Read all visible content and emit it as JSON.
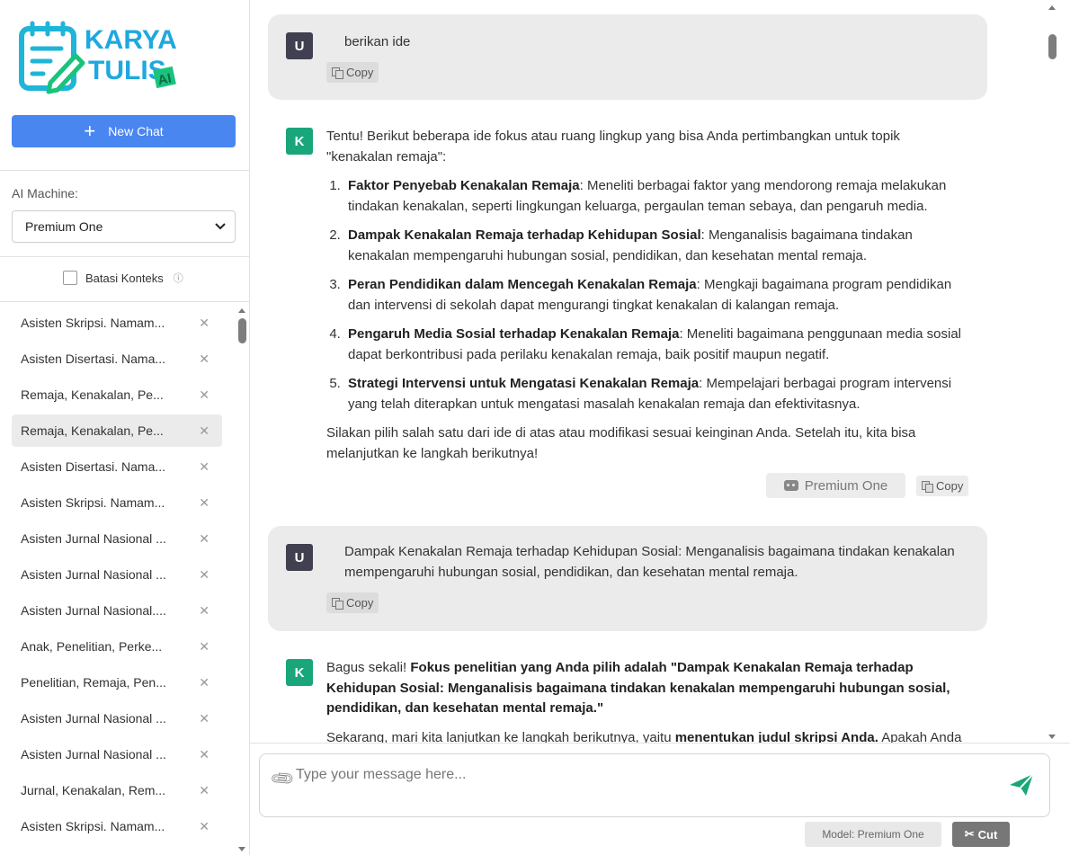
{
  "sidebar": {
    "logo": {
      "line1": "KARYA",
      "line2": "TULIS",
      "badge": "AI",
      "colors": {
        "primary": "#1fa8e0",
        "accent": "#19c37d"
      }
    },
    "new_chat_label": "New Chat",
    "ai_machine_label": "AI Machine:",
    "ai_machine_value": "Premium One",
    "batasi_label": "Batasi Konteks",
    "history": [
      "Asisten Skripsi. Namam...",
      "Asisten Disertasi. Nama...",
      "Remaja, Kenakalan, Pe...",
      "Remaja, Kenakalan, Pe...",
      "Asisten Disertasi. Nama...",
      "Asisten Skripsi. Namam...",
      "Asisten Jurnal Nasional ...",
      "Asisten Jurnal Nasional ...",
      "Asisten Jurnal Nasional....",
      "Anak, Penelitian, Perke...",
      "Penelitian, Remaja, Pen...",
      "Asisten Jurnal Nasional ...",
      "Asisten Jurnal Nasional ...",
      "Jurnal, Kenakalan, Rem...",
      "Asisten Skripsi. Namam..."
    ],
    "active_index": 3
  },
  "chat": {
    "user_avatar": "U",
    "ai_avatar": "K",
    "copy_label": "Copy",
    "msg1": "berikan ide",
    "ai1": {
      "intro": "Tentu! Berikut beberapa ide fokus atau ruang lingkup yang bisa Anda pertimbangkan untuk topik \"kenakalan remaja\":",
      "items": [
        {
          "title": "Faktor Penyebab Kenakalan Remaja",
          "desc": ": Meneliti berbagai faktor yang mendorong remaja melakukan tindakan kenakalan, seperti lingkungan keluarga, pergaulan teman sebaya, dan pengaruh media."
        },
        {
          "title": "Dampak Kenakalan Remaja terhadap Kehidupan Sosial",
          "desc": ": Menganalisis bagaimana tindakan kenakalan mempengaruhi hubungan sosial, pendidikan, dan kesehatan mental remaja."
        },
        {
          "title": "Peran Pendidikan dalam Mencegah Kenakalan Remaja",
          "desc": ": Mengkaji bagaimana program pendidikan dan intervensi di sekolah dapat mengurangi tingkat kenakalan di kalangan remaja."
        },
        {
          "title": "Pengaruh Media Sosial terhadap Kenakalan Remaja",
          "desc": ": Meneliti bagaimana penggunaan media sosial dapat berkontribusi pada perilaku kenakalan remaja, baik positif maupun negatif."
        },
        {
          "title": "Strategi Intervensi untuk Mengatasi Kenakalan Remaja",
          "desc": ": Mempelajari berbagai program intervensi yang telah diterapkan untuk mengatasi masalah kenakalan remaja dan efektivitasnya."
        }
      ],
      "outro": "Silakan pilih salah satu dari ide di atas atau modifikasi sesuai keinginan Anda. Setelah itu, kita bisa melanjutkan ke langkah berikutnya!",
      "model": "Premium One"
    },
    "msg2": "Dampak Kenakalan Remaja terhadap Kehidupan Sosial: Menganalisis bagaimana tindakan kenakalan mempengaruhi hubungan sosial, pendidikan, dan kesehatan mental remaja.",
    "ai2": {
      "lead": "Bagus sekali! ",
      "bold": "Fokus penelitian yang Anda pilih adalah \"Dampak Kenakalan Remaja terhadap Kehidupan Sosial: Menganalisis bagaimana tindakan kenakalan mempengaruhi hubungan sosial, pendidikan, dan kesehatan mental remaja.\"",
      "next_a": "Sekarang, mari kita lanjutkan ke langkah berikutnya, yaitu ",
      "next_b": "menentukan judul skripsi Anda.",
      "next_c": " Apakah Anda"
    }
  },
  "input": {
    "placeholder": "Type your message here...",
    "model_label": "Model: Premium One",
    "cut_label": "Cut"
  }
}
